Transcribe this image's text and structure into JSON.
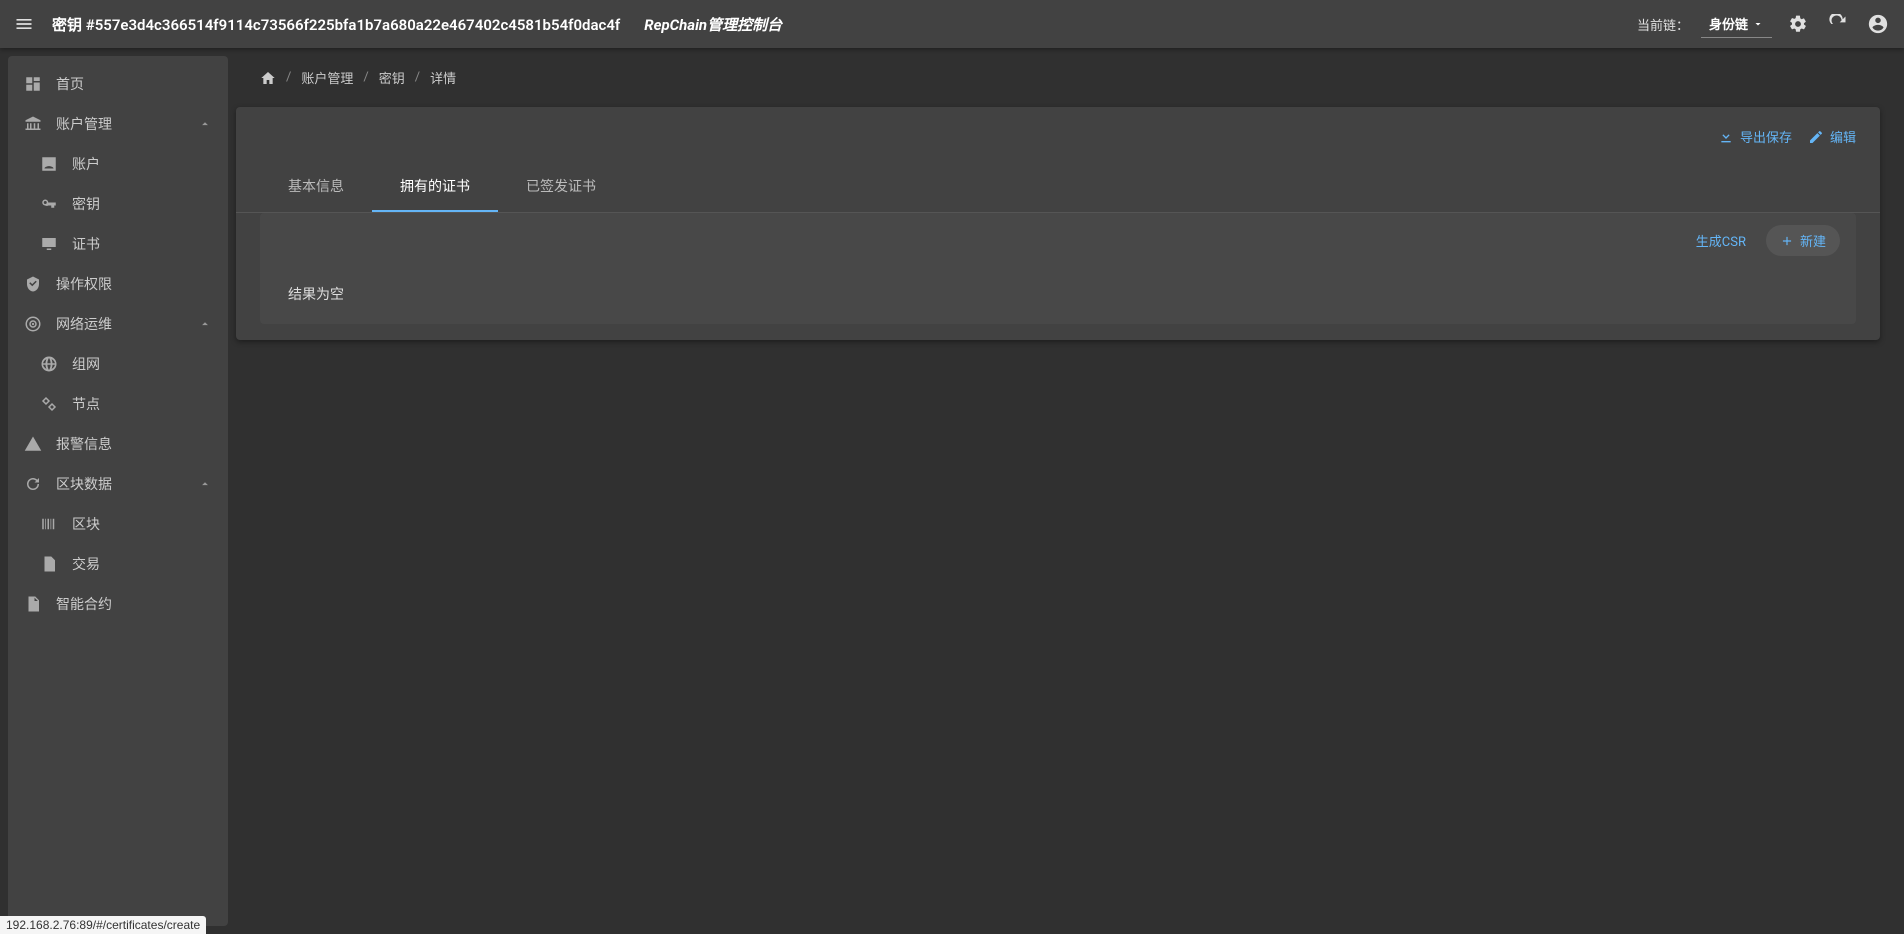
{
  "header": {
    "page_title": "密钥 #557e3d4c366514f9114c73566f225bfa1b7a680a22e467402c4581b54f0dac4f",
    "brand_title": "RepChain管理控制台",
    "chain_label": "当前链：",
    "chain_value": "身份链"
  },
  "sidebar": {
    "home": "首页",
    "account_mgmt": "账户管理",
    "account": "账户",
    "key": "密钥",
    "cert": "证书",
    "op_perm": "操作权限",
    "net_ops": "网络运维",
    "networking": "组网",
    "node": "节点",
    "alert": "报警信息",
    "block_data": "区块数据",
    "block": "区块",
    "tx": "交易",
    "contract": "智能合约"
  },
  "breadcrumb": {
    "b1": "账户管理",
    "b2": "密钥",
    "b3": "详情"
  },
  "actions": {
    "export_save": "导出保存",
    "edit": "编辑",
    "gen_csr": "生成CSR",
    "new": "新建"
  },
  "tabs": {
    "t1": "基本信息",
    "t2": "拥有的证书",
    "t3": "已签发证书"
  },
  "content": {
    "empty": "结果为空"
  },
  "status_url": "192.168.2.76:89/#/certificates/create"
}
